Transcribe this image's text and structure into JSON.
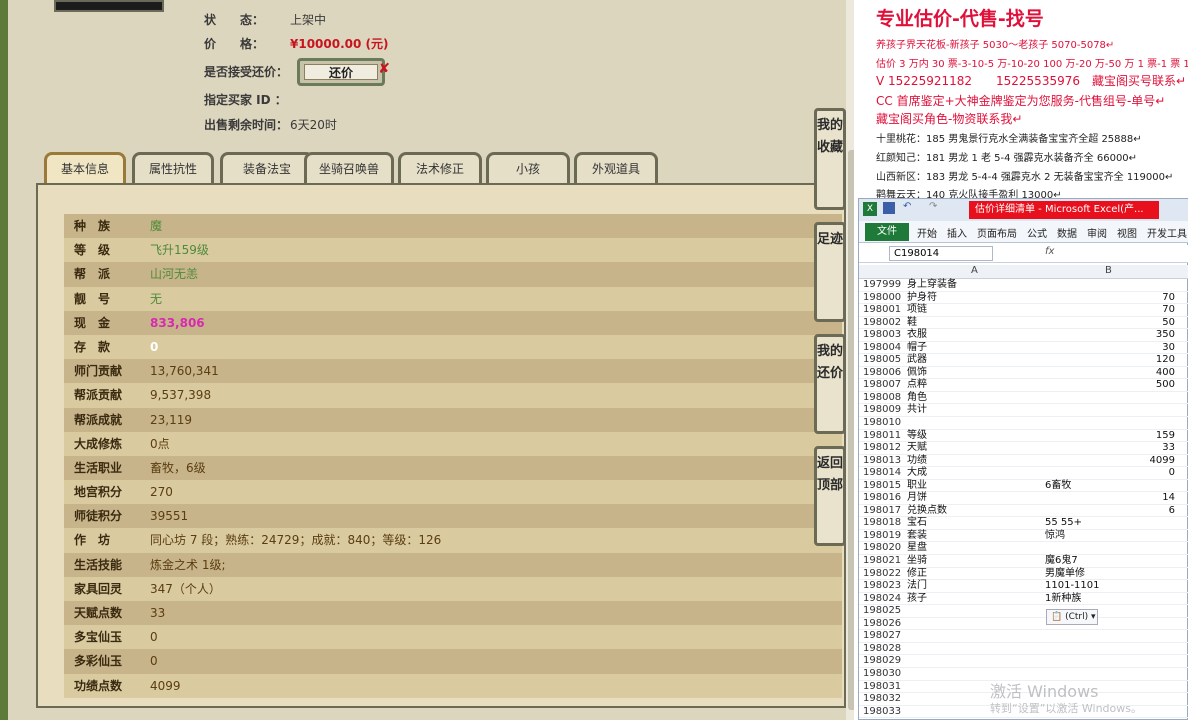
{
  "status": {
    "label": "状　　态：",
    "value": "上架中"
  },
  "price": {
    "label": "价　　格：",
    "value": "¥10000.00 (元)"
  },
  "bargain": {
    "label": "是否接受还价：",
    "button": "还价"
  },
  "buyer": {
    "label": "指定买家 ID ：",
    "value": ""
  },
  "remain": {
    "label": "出售剩余时间：",
    "value": "6天20时"
  },
  "tabs": [
    "基本信息",
    "属性抗性",
    "装备法宝",
    "坐骑召唤兽",
    "法术修正",
    "小孩",
    "外观道具"
  ],
  "side_buttons": [
    "我的收藏",
    "足迹",
    "我的还价",
    "返回顶部"
  ],
  "rows": [
    {
      "k": "种　族",
      "v": "魔",
      "style": "green"
    },
    {
      "k": "等　级",
      "v": "飞升159级",
      "style": "green"
    },
    {
      "k": "帮　派",
      "v": "山河无恙",
      "style": "green"
    },
    {
      "k": "靓　号",
      "v": "无",
      "style": "green"
    },
    {
      "k": "现　金",
      "v": "833,806",
      "style": "pink"
    },
    {
      "k": "存　款",
      "v": "0",
      "style": "white"
    },
    {
      "k": "师门贡献",
      "v": "13,760,341",
      "style": ""
    },
    {
      "k": "帮派贡献",
      "v": "9,537,398",
      "style": ""
    },
    {
      "k": "帮派成就",
      "v": "23,119",
      "style": ""
    },
    {
      "k": "大成修炼",
      "v": "0点",
      "style": ""
    },
    {
      "k": "生活职业",
      "v": "畜牧，6级",
      "style": ""
    },
    {
      "k": "地宫积分",
      "v": "270",
      "style": ""
    },
    {
      "k": "师徒积分",
      "v": "39551",
      "style": ""
    },
    {
      "k": "作　坊",
      "v": "同心坊 7 段；熟练：24729；成就：840；等级：126",
      "style": ""
    },
    {
      "k": "生活技能",
      "v": "炼金之术 1级;",
      "style": ""
    },
    {
      "k": "家具回灵",
      "v": "347（个人）",
      "style": ""
    },
    {
      "k": "天赋点数",
      "v": "33",
      "style": ""
    },
    {
      "k": "多宝仙玉",
      "v": "0",
      "style": ""
    },
    {
      "k": "多彩仙玉",
      "v": "0",
      "style": ""
    },
    {
      "k": "功绩点数",
      "v": "4099",
      "style": ""
    }
  ],
  "promo": {
    "title": "专业估价-代售-找号",
    "lines": [
      "养孩子界天花板-新孩子 5030～老孩子 5070-5078↵",
      "估价 3 万内 30 票-3-10-5 万-10-20 100 万-20 万-50 万 1 票-1 票 1",
      "V 15225921182　　15225535976　藏宝阁买号联系↵",
      "CC 首席鉴定+大神金牌鉴定为您服务-代售组号-单号↵",
      "藏宝阁买角色-物资联系我↵"
    ],
    "listings": [
      "十里桃花：185 男鬼景行克水全满装备宝宝齐全超 25888↵",
      "红颜知己：181 男龙 1 老 5-4 强霹克水装备齐全 66000↵",
      "山西新区：183 男龙 5-4-4 强霹克水 2 无装备宝宝齐全 119000↵",
      "鹳舞云天：140 克火队接手盈利 13000↵"
    ]
  },
  "excel": {
    "title": "估价详细清单 - Microsoft Excel(产...",
    "menus": [
      "开始",
      "插入",
      "页面布局",
      "公式",
      "数据",
      "审阅",
      "视图",
      "开发工具"
    ],
    "file_tab": "文件",
    "name_box": "C198014",
    "fx": "fx",
    "col_a": "A",
    "col_b": "B",
    "rows": [
      {
        "n": "197999",
        "a": "身上穿装备",
        "b": "",
        "e": ""
      },
      {
        "n": "198000",
        "a": "护身符",
        "b": "",
        "e": "70"
      },
      {
        "n": "198001",
        "a": "项链",
        "b": "",
        "e": "70"
      },
      {
        "n": "198002",
        "a": "鞋",
        "b": "",
        "e": "50"
      },
      {
        "n": "198003",
        "a": "衣服",
        "b": "",
        "e": "350"
      },
      {
        "n": "198004",
        "a": "帽子",
        "b": "",
        "e": "30"
      },
      {
        "n": "198005",
        "a": "武器",
        "b": "",
        "e": "120"
      },
      {
        "n": "198006",
        "a": "佩饰",
        "b": "",
        "e": "400"
      },
      {
        "n": "198007",
        "a": "点粹",
        "b": "",
        "e": "500"
      },
      {
        "n": "198008",
        "a": "角色",
        "b": "",
        "e": ""
      },
      {
        "n": "198009",
        "a": "共计",
        "b": "",
        "e": ""
      },
      {
        "n": "198010",
        "a": "",
        "b": "",
        "e": ""
      },
      {
        "n": "198011",
        "a": "等级",
        "b": "",
        "e": "159"
      },
      {
        "n": "198012",
        "a": "天赋",
        "b": "",
        "e": "33"
      },
      {
        "n": "198013",
        "a": "功绩",
        "b": "",
        "e": "4099"
      },
      {
        "n": "198014",
        "a": "大成",
        "b": "",
        "e": "0"
      },
      {
        "n": "198015",
        "a": "职业",
        "b": "6畜牧",
        "e": ""
      },
      {
        "n": "198016",
        "a": "月饼",
        "b": "",
        "e": "14"
      },
      {
        "n": "198017",
        "a": "兑换点数",
        "b": "",
        "e": "6"
      },
      {
        "n": "198018",
        "a": "宝石",
        "b": "55 55+",
        "e": ""
      },
      {
        "n": "198019",
        "a": "套装",
        "b": "惊鸿",
        "e": ""
      },
      {
        "n": "198020",
        "a": "星盘",
        "b": "",
        "e": ""
      },
      {
        "n": "198021",
        "a": "坐骑",
        "b": "魔6鬼7",
        "e": ""
      },
      {
        "n": "198022",
        "a": "修正",
        "b": "男魔单修",
        "e": ""
      },
      {
        "n": "198023",
        "a": "法门",
        "b": "1101-1101",
        "e": ""
      },
      {
        "n": "198024",
        "a": "孩子",
        "b": "1新种族",
        "e": ""
      },
      {
        "n": "198025",
        "a": "",
        "b": "",
        "e": ""
      },
      {
        "n": "198026",
        "a": "",
        "b": "",
        "e": ""
      },
      {
        "n": "198027",
        "a": "",
        "b": "",
        "e": ""
      },
      {
        "n": "198028",
        "a": "",
        "b": "",
        "e": ""
      },
      {
        "n": "198029",
        "a": "",
        "b": "",
        "e": ""
      },
      {
        "n": "198030",
        "a": "",
        "b": "",
        "e": ""
      },
      {
        "n": "198031",
        "a": "",
        "b": "",
        "e": ""
      },
      {
        "n": "198032",
        "a": "",
        "b": "",
        "e": ""
      },
      {
        "n": "198033",
        "a": "",
        "b": "",
        "e": ""
      }
    ],
    "paste_ctrl": "(Ctrl) ▾"
  },
  "watermark": {
    "line1": "激活 Windows",
    "line2": "转到“设置”以激活 Windows。"
  }
}
